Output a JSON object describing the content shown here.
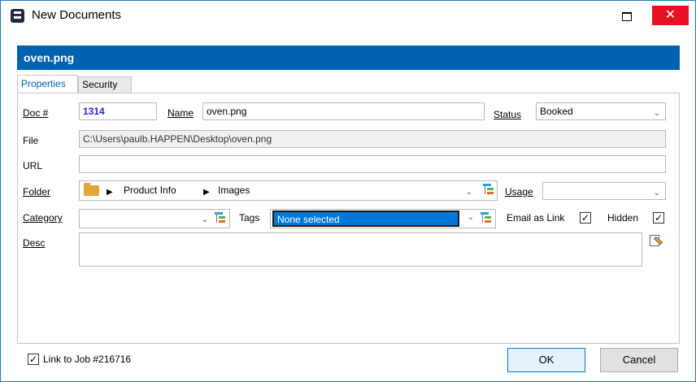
{
  "window": {
    "title": "New Documents",
    "minimize_glyph": "",
    "close_glyph": "✕"
  },
  "header": {
    "filename": "oven.png"
  },
  "tabs": [
    {
      "label": "Properties",
      "active": true
    },
    {
      "label": "Security",
      "active": false
    }
  ],
  "form": {
    "doc": {
      "label": "Doc #",
      "value": "1314"
    },
    "name": {
      "label": "Name",
      "value": "oven.png"
    },
    "status": {
      "label": "Status",
      "value": "Booked"
    },
    "file": {
      "label": "File",
      "value": "C:\\Users\\paulb.HAPPEN\\Desktop\\oven.png"
    },
    "url": {
      "label": "URL",
      "value": ""
    },
    "folder": {
      "label": "Folder",
      "path": [
        "Product Info",
        "Images"
      ]
    },
    "usage": {
      "label": "Usage",
      "value": ""
    },
    "category": {
      "label": "Category",
      "value": ""
    },
    "tags": {
      "label": "Tags",
      "value": "None selected"
    },
    "email_as_link": {
      "label": "Email as Link",
      "checked": true
    },
    "hidden": {
      "label": "Hidden",
      "checked": true
    },
    "desc": {
      "label": "Desc",
      "value": ""
    }
  },
  "footer": {
    "link_to_job": {
      "label": "Link to Job #216716",
      "checked": true
    },
    "ok_label": "OK",
    "cancel_label": "Cancel"
  },
  "glyphs": {
    "check": "✓",
    "chevron": "⌄",
    "arrow": "▶"
  },
  "colors": {
    "accent": "#0063b1",
    "close": "#e81123",
    "selection": "#0078d7",
    "doc_number": "#1c2fd1"
  }
}
